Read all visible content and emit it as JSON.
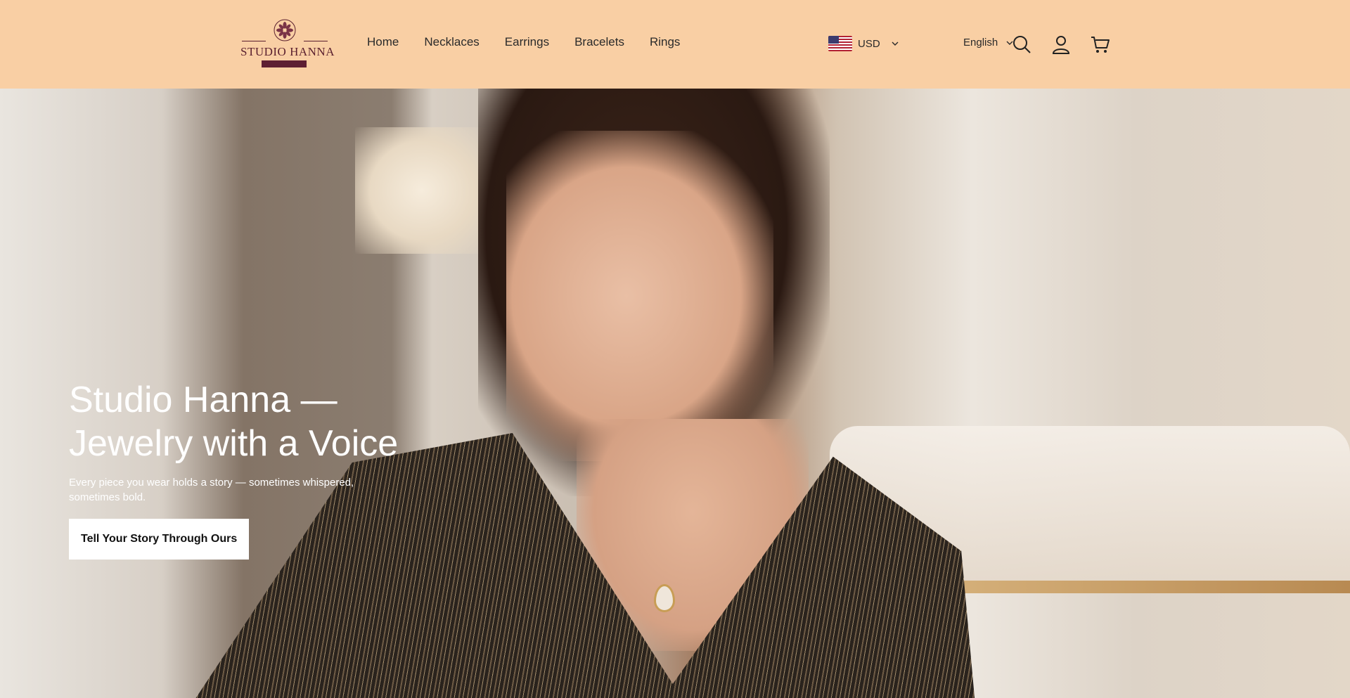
{
  "brand": {
    "logo_text": "STUDIO  HANNA",
    "accent": "#5e1f33",
    "header_bg": "#f9cfa4"
  },
  "nav": {
    "items": [
      {
        "label": "Home"
      },
      {
        "label": "Necklaces"
      },
      {
        "label": "Earrings"
      },
      {
        "label": "Bracelets"
      },
      {
        "label": "Rings"
      }
    ]
  },
  "currency": {
    "selected": "USD",
    "flag_icon": "us-flag-icon",
    "chevron_icon": "chevron-down-icon"
  },
  "language": {
    "selected": "English",
    "chevron_icon": "chevron-down-icon"
  },
  "header_icons": {
    "search": "search-icon",
    "account": "user-icon",
    "cart": "cart-icon"
  },
  "hero": {
    "title_line1": "Studio Hanna —",
    "title_line2": "Jewelry with a Voice",
    "subtitle": "Every piece you wear holds a story — sometimes whispered, sometimes bold.",
    "cta_label": "Tell Your Story Through Ours"
  }
}
